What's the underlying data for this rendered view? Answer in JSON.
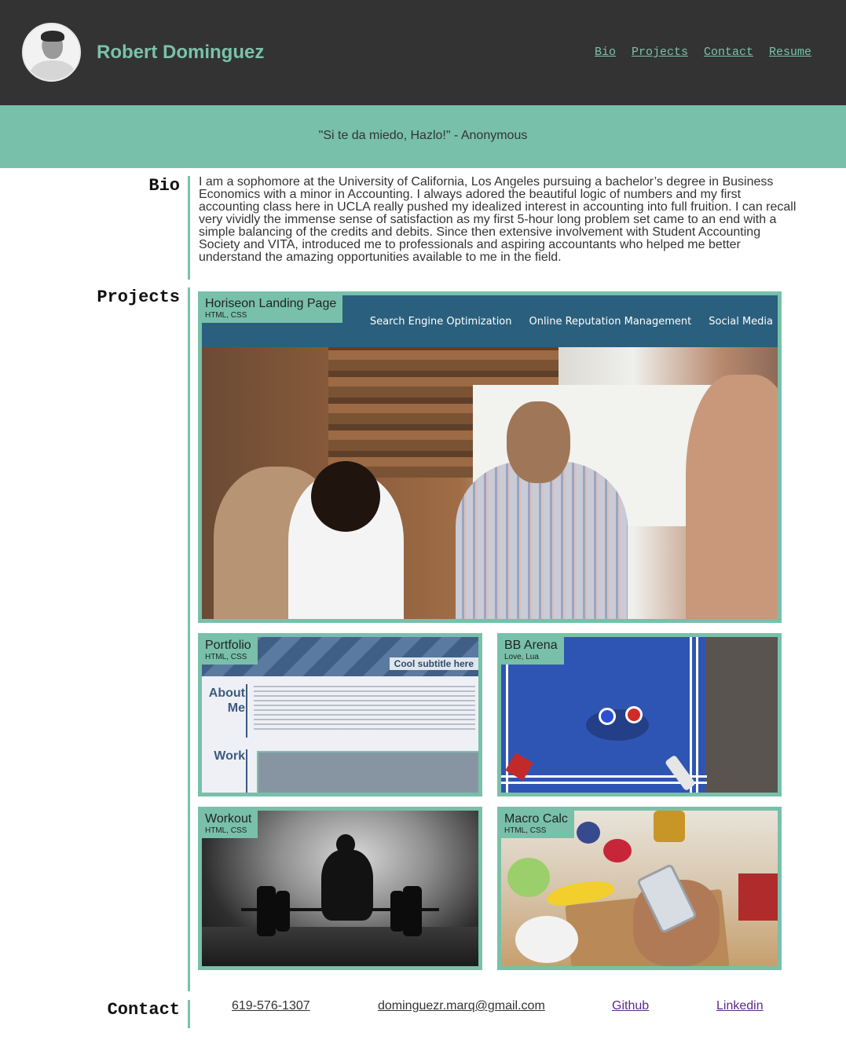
{
  "header": {
    "name": "Robert Dominguez",
    "nav": [
      "Bio",
      "Projects",
      "Contact",
      "Resume"
    ]
  },
  "quote": "\"Si te da miedo, Hazlo!\" - Anonymous",
  "sections": {
    "bio_label": "Bio",
    "projects_label": "Projects",
    "contact_label": "Contact"
  },
  "bio": "I am a sophomore at the University of California, Los Angeles pursuing a bachelor’s degree in Business Economics with a minor in Accounting. I always adored the beautiful logic of numbers and my first accounting class here in UCLA really pushed my idealized interest in accounting into full fruition. I can recall very vividly the immense sense of satisfaction as my first 5-hour long problem set came to an end with a simple balancing of the credits and debits. Since then extensive involvement with Student Accounting Society and VITA, introduced me to professionals and aspiring accountants who helped me better understand the amazing opportunities available to me in the field.",
  "projects": [
    {
      "title": "Horiseon Landing Page",
      "tech": "HTML, CSS",
      "screenshot_nav": [
        "Search Engine Optimization",
        "Online Reputation Management",
        "Social Media"
      ]
    },
    {
      "title": "Portfolio",
      "tech": "HTML, CSS",
      "screenshot_text": {
        "subtitle": "Cool subtitle here",
        "about": "About Me",
        "work": "Work"
      }
    },
    {
      "title": "BB Arena",
      "tech": "Love, Lua"
    },
    {
      "title": "Workout",
      "tech": "HTML, CSS"
    },
    {
      "title": "Macro Calc",
      "tech": "HTML, CSS"
    }
  ],
  "contact": {
    "phone": "619-576-1307",
    "email": "dominguezr.marq@gmail.com",
    "github": "Github",
    "linkedin": "Linkedin"
  },
  "colors": {
    "header_bg": "#333333",
    "accent": "#78c0a9",
    "text": "#333333",
    "visited_link": "#5a2b86"
  }
}
